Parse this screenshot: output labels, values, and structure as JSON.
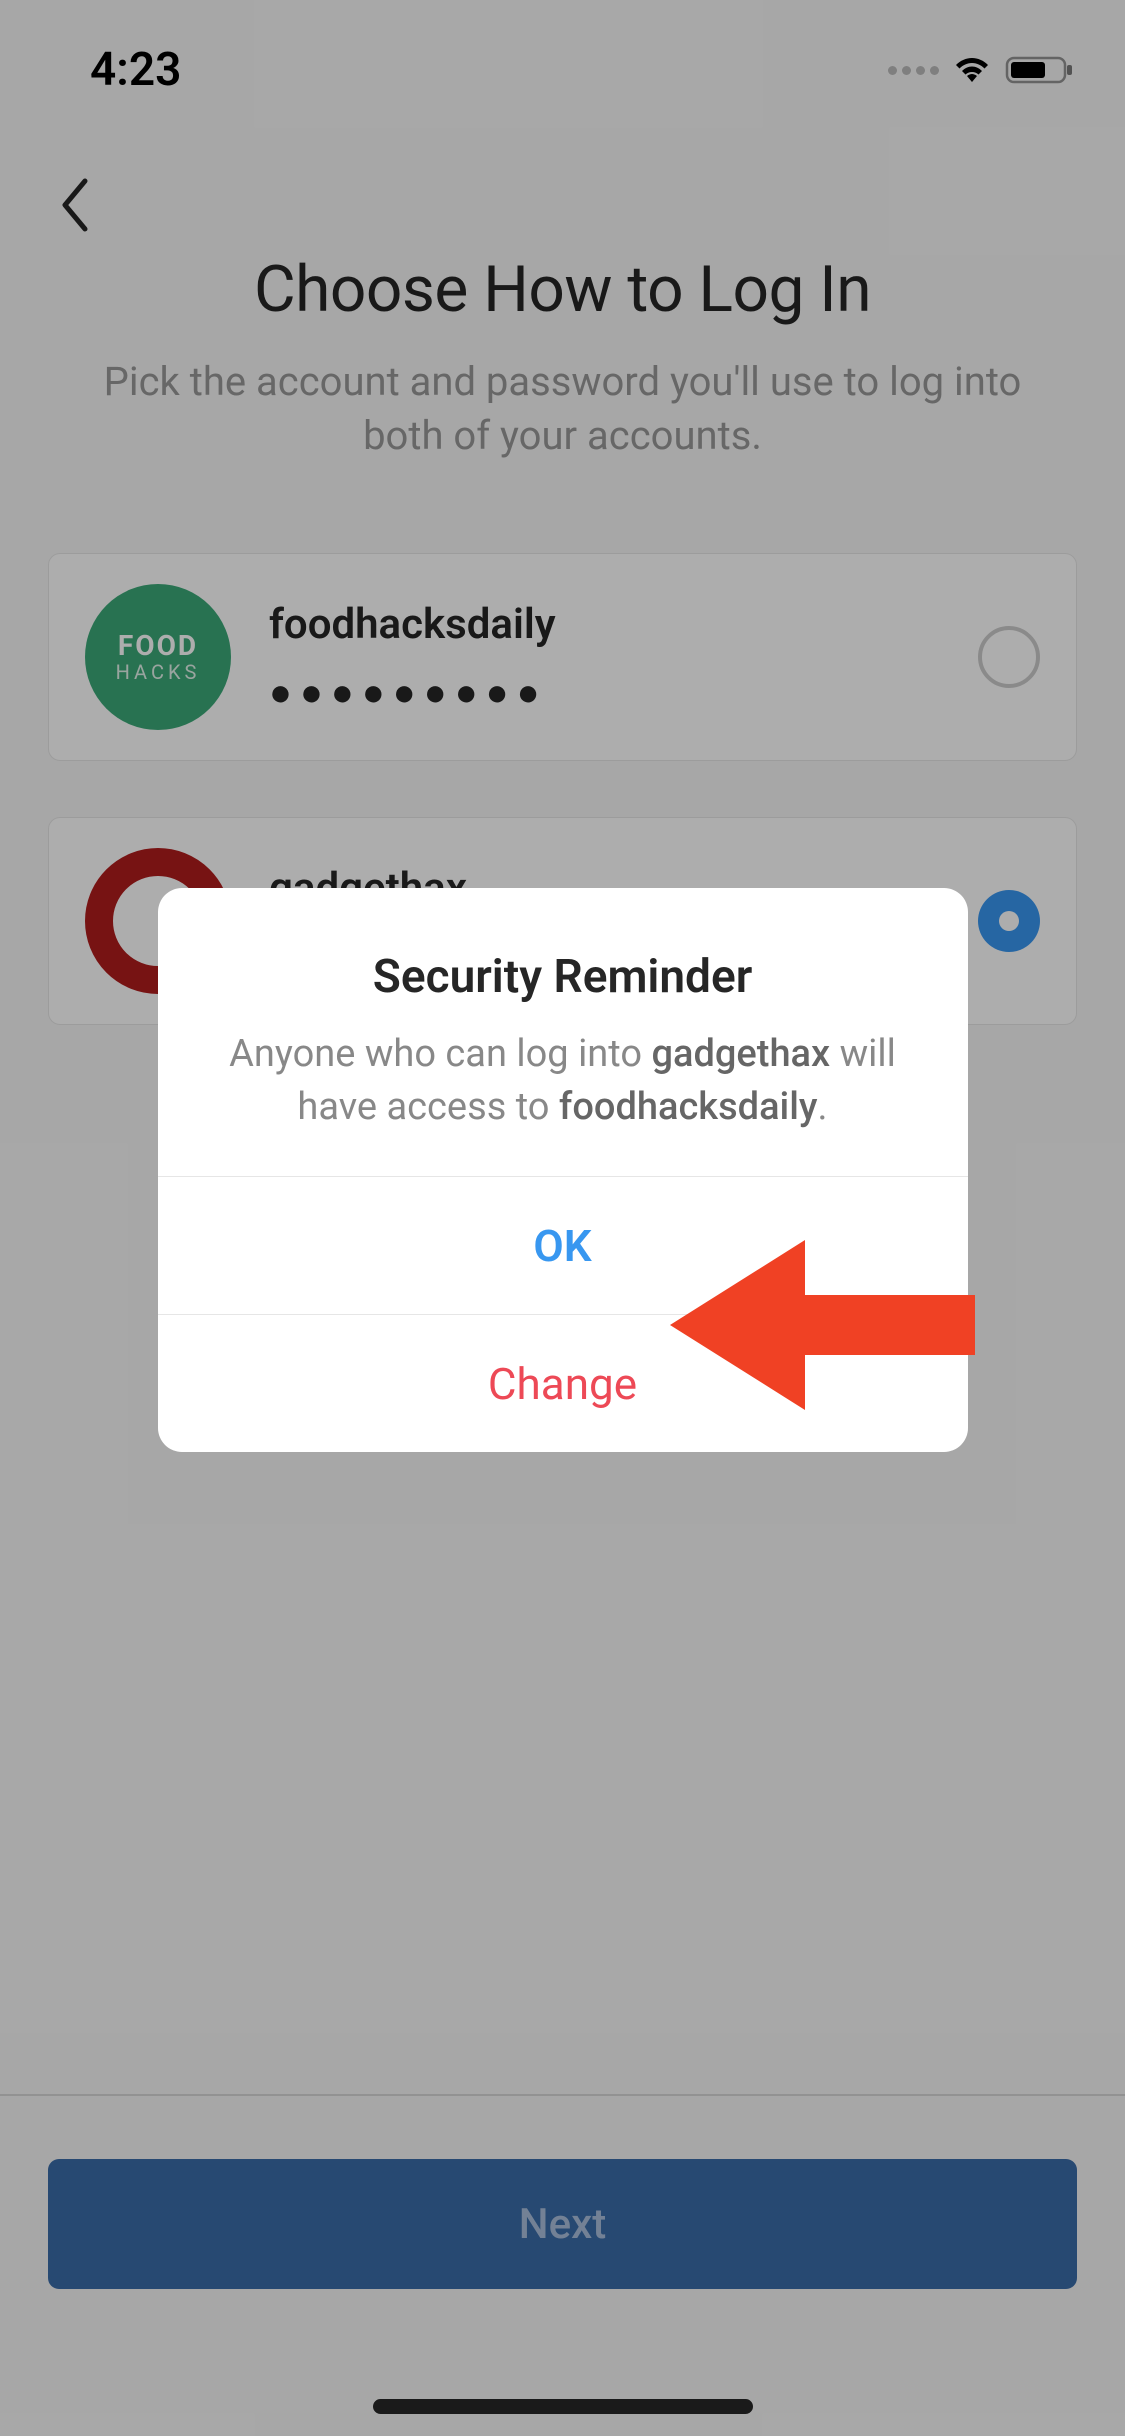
{
  "status_bar": {
    "time": "4:23"
  },
  "page": {
    "title": "Choose How to Log In",
    "subtitle": "Pick the account and password you'll use to log into both of your accounts."
  },
  "accounts": [
    {
      "username": "foodhacksdaily",
      "password_masked": "●●●●●●●●●",
      "avatar_line1": "FOOD",
      "avatar_line2": "HACKS",
      "selected": false
    },
    {
      "username": "gadgethax",
      "password_masked": "●●●●●●●●●",
      "selected": true
    }
  ],
  "dialog": {
    "title": "Security Reminder",
    "message_prefix": "Anyone who can log into ",
    "message_account1": "gadgethax",
    "message_middle": " will have access to ",
    "message_account2": "foodhacksdaily",
    "message_suffix": ".",
    "ok_label": "OK",
    "change_label": "Change"
  },
  "footer": {
    "next_label": "Next"
  }
}
